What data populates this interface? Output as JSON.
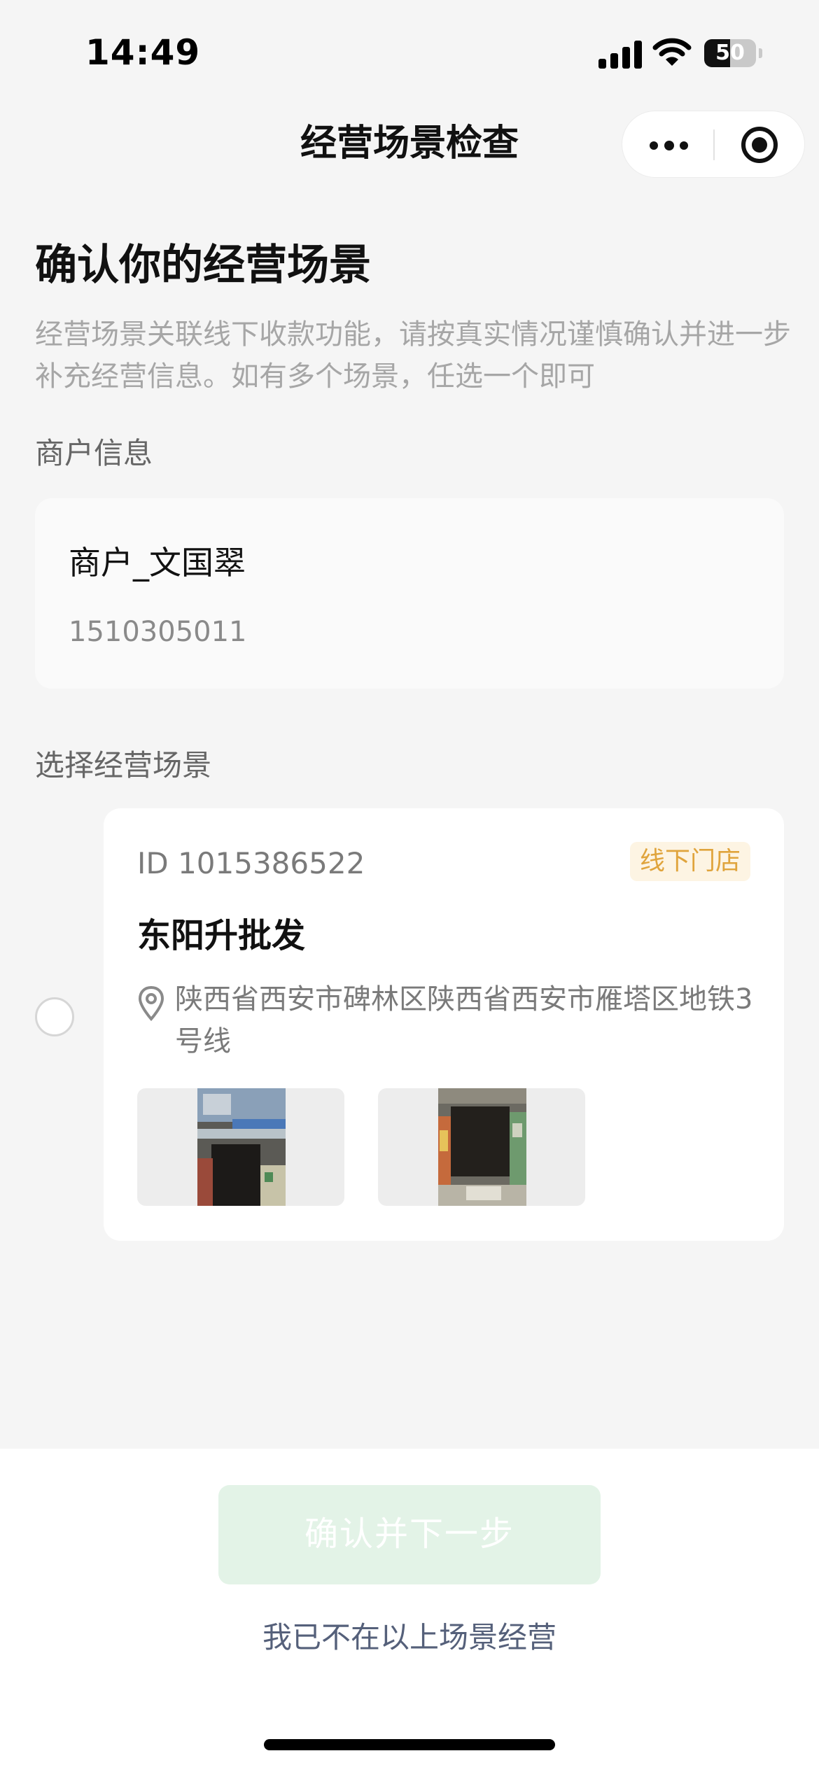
{
  "status_bar": {
    "time": "14:49",
    "battery": "50",
    "battery_level": 0.5
  },
  "nav": {
    "title": "经营场景检查"
  },
  "page": {
    "heading": "确认你的经营场景",
    "description": "经营场景关联线下收款功能，请按真实情况谨慎确认并进一步补充经营信息。如有多个场景，任选一个即可"
  },
  "merchant_section": {
    "label": "商户信息",
    "name": "商户_文国翠",
    "id": "1510305011"
  },
  "scene_section": {
    "label": "选择经营场景",
    "scenes": [
      {
        "id_text": "ID 1015386522",
        "tag": "线下门店",
        "name": "东阳升批发",
        "address": "陕西省西安市碑林区陕西省西安市雁塔区地铁3号线",
        "selected": false,
        "photo_count": 2
      }
    ]
  },
  "footer": {
    "confirm_label": "确认并下一步",
    "not_here_label": "我已不在以上场景经营"
  },
  "colors": {
    "accent_disabled": "#e3f3e7",
    "tag_text": "#e0a43c",
    "tag_bg": "#fdf4e3",
    "link": "#55607a"
  },
  "icons": [
    "signal-icon",
    "wifi-icon",
    "battery-icon",
    "more-dots-icon",
    "target-icon",
    "location-pin-icon"
  ]
}
